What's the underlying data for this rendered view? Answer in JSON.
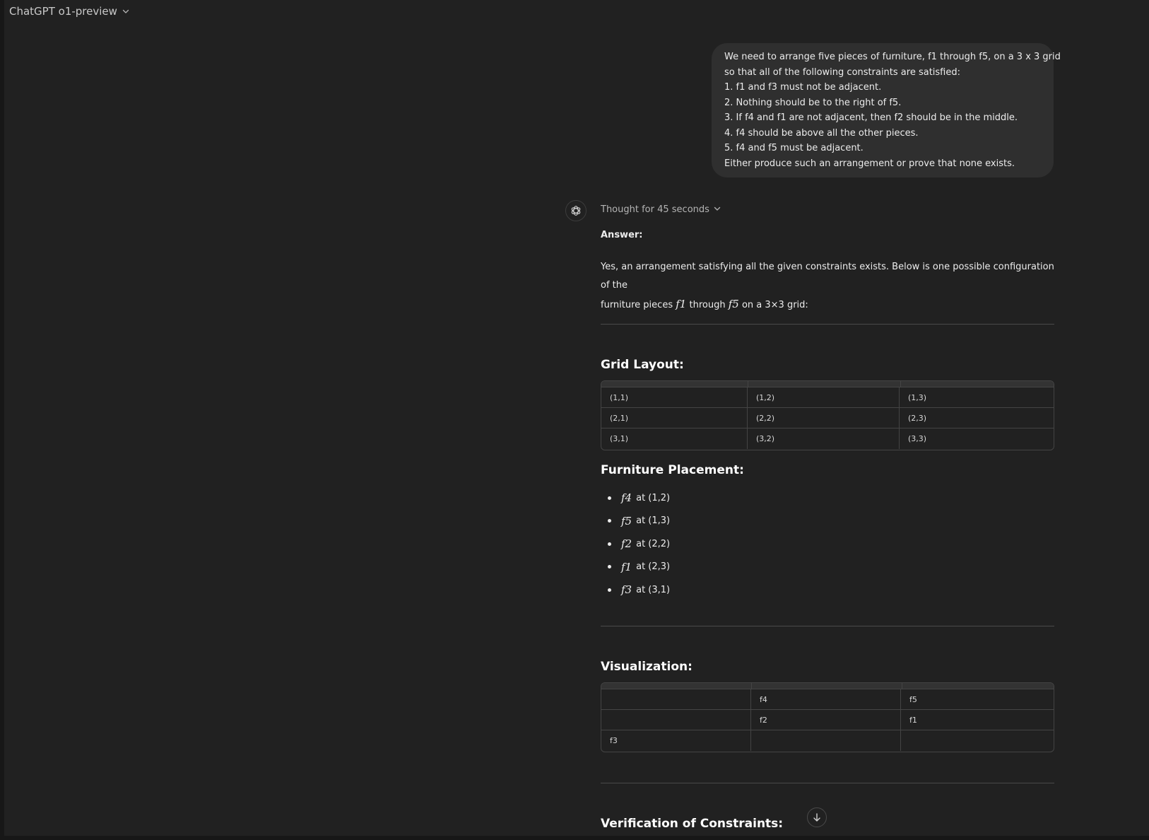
{
  "header": {
    "model_name": "ChatGPT o1-preview"
  },
  "user_message": {
    "lines": [
      "We need to arrange five pieces of furniture, f1 through f5, on a 3 x 3 grid",
      "so that all of the following constraints are satisfied:",
      "1. f1 and f3 must not be adjacent.",
      "2. Nothing should be to the right of f5.",
      "3. If f4 and f1 are not adjacent, then f2 should be in the middle.",
      "4. f4 should be above all the other pieces.",
      "5. f4 and f5 must be adjacent.",
      "Either produce such an arrangement or prove that none exists."
    ]
  },
  "assistant": {
    "thought_label": "Thought for 45 seconds",
    "answer_label": "Answer:",
    "intro_part1": "Yes, an arrangement satisfying all the given constraints exists. Below is one possible configuration of the",
    "intro_part2": "furniture pieces",
    "intro_math1": "f1",
    "intro_part3": "through",
    "intro_math2": "f5",
    "intro_part4": "on a 3×3 grid:",
    "grid_layout_title": "Grid Layout:",
    "grid_layout_rows": [
      [
        "(1,1)",
        "(1,2)",
        "(1,3)"
      ],
      [
        "(2,1)",
        "(2,2)",
        "(2,3)"
      ],
      [
        "(3,1)",
        "(3,2)",
        "(3,3)"
      ]
    ],
    "placement_title": "Furniture Placement:",
    "placements": [
      {
        "piece": "f4",
        "text": "at (1,2)"
      },
      {
        "piece": "f5",
        "text": "at (1,3)"
      },
      {
        "piece": "f2",
        "text": "at (2,2)"
      },
      {
        "piece": "f1",
        "text": "at (2,3)"
      },
      {
        "piece": "f3",
        "text": "at (3,1)"
      }
    ],
    "visualization_title": "Visualization:",
    "visualization_rows": [
      [
        "",
        "f4",
        "f5"
      ],
      [
        "",
        "f2",
        "f1"
      ],
      [
        "f3",
        "",
        ""
      ]
    ],
    "verification_title": "Verification of Constraints:"
  },
  "icons": {
    "model_chevron": "chevron-down-icon",
    "thought_chevron": "chevron-down-icon",
    "avatar": "openai-logo-icon",
    "scroll": "arrow-down-icon"
  }
}
